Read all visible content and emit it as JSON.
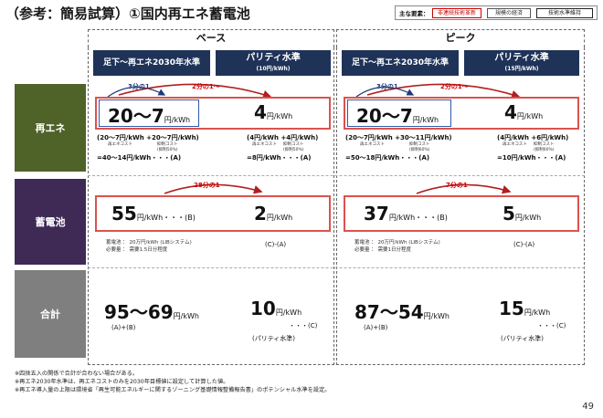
{
  "title": "（参考：簡易試算）①国内再エネ蓄電池",
  "legend": {
    "label": "主な要素：",
    "items": [
      "非連続技術革新",
      "規模の経済",
      "技術水準維持"
    ]
  },
  "columns": {
    "base": "ベース",
    "peak": "ピーク",
    "base_left": "足下～再エネ2030年水準",
    "base_right_main": "パリティ水準",
    "base_right_sub": "(10円/kWh)",
    "peak_left": "足下～再エネ2030年水準",
    "peak_right_main": "パリティ水準",
    "peak_right_sub": "(15円/kWh)"
  },
  "rows": {
    "renewable": "再エネ",
    "battery": "蓄電池",
    "total": "合計"
  },
  "renewable": {
    "base_left_value": "20～7",
    "base_left_unit": "円/kWh",
    "base_right_value": "4",
    "base_right_unit": "円/kWh",
    "base_ratio_blue": "3分の1",
    "base_ratio_red": "2分の1～",
    "base_left_formula": "(20～7円/kWh +20～7円/kWh)",
    "base_left_note1": "再エネコスト",
    "base_left_note2": "抑制コスト (抑制50%)",
    "base_left_result": "=40～14円/kWh・・・(A)",
    "base_right_formula": "(4円/kWh +4円/kWh)",
    "base_right_note1": "再エネコスト",
    "base_right_note2": "抑制コスト (抑制50%)",
    "base_right_result": "=8円/kWh・・・(A)",
    "peak_left_value": "20～7",
    "peak_left_unit": "円/kWh",
    "peak_right_value": "4",
    "peak_right_unit": "円/kWh",
    "peak_ratio_blue": "3分の1",
    "peak_ratio_red": "2分の1～",
    "peak_left_formula": "(20～7円/kWh +30～11円/kWh)",
    "peak_left_note1": "再エネコスト",
    "peak_left_note2": "抑制コスト (抑制60%)",
    "peak_left_result": "=50～18円/kWh・・・(A)",
    "peak_right_formula": "(4円/kWh +6円/kWh)",
    "peak_right_note1": "再エネコスト",
    "peak_right_note2": "抑制コスト (抑制60%)",
    "peak_right_result": "=10円/kWh・・・(A)"
  },
  "battery": {
    "base_ratio": "28分の1",
    "base_left_value": "55",
    "base_left_unit": "円/kWh・・・(B)",
    "base_left_note1": "蓄電池 ： 20万円/kWh (LIBシステム)",
    "base_left_note2": "必要量 ： 需要1.5日分程度",
    "base_right_value": "2",
    "base_right_unit": "円/kWh",
    "base_right_note": "(C)-(A)",
    "peak_ratio": "7分の1",
    "peak_left_value": "37",
    "peak_left_unit": "円/kWh・・・(B)",
    "peak_left_note1": "蓄電池 ： 20万円/kWh (LIBシステム)",
    "peak_left_note2": "必要量 ： 需要1日分程度",
    "peak_right_value": "5",
    "peak_right_unit": "円/kWh",
    "peak_right_note": "(C)-(A)"
  },
  "total": {
    "base_left_value": "95～69",
    "base_left_unit": "円/kWh",
    "base_left_note": "(A)+(B)",
    "base_right_value": "10",
    "base_right_unit": "円/kWh",
    "base_right_note1": "・・・(C)",
    "base_right_note2": "(パリティ水準)",
    "peak_left_value": "87～54",
    "peak_left_unit": "円/kWh",
    "peak_left_note": "(A)+(B)",
    "peak_right_value": "15",
    "peak_right_unit": "円/kWh",
    "peak_right_note1": "・・・(C)",
    "peak_right_note2": "(パリティ水準)"
  },
  "notes": [
    "※四捨五入の関係で合計が合わない場合がある。",
    "※再エネ2030年水準は、再エネコストのみを2030年目標値に設定して計算した値。",
    "※再エネ導入量の上限は環境省「再生可能エネルギーに関するゾーニング基礎情報整備報告書」のポテンシャル水準を設定。"
  ],
  "page_number": "49",
  "colors": {
    "navy": "#1f3358",
    "green": "#4f6228",
    "purple": "#3f2a56",
    "gray": "#7f7f7f",
    "red": "#d9534f",
    "blue": "#2e5aa8"
  }
}
